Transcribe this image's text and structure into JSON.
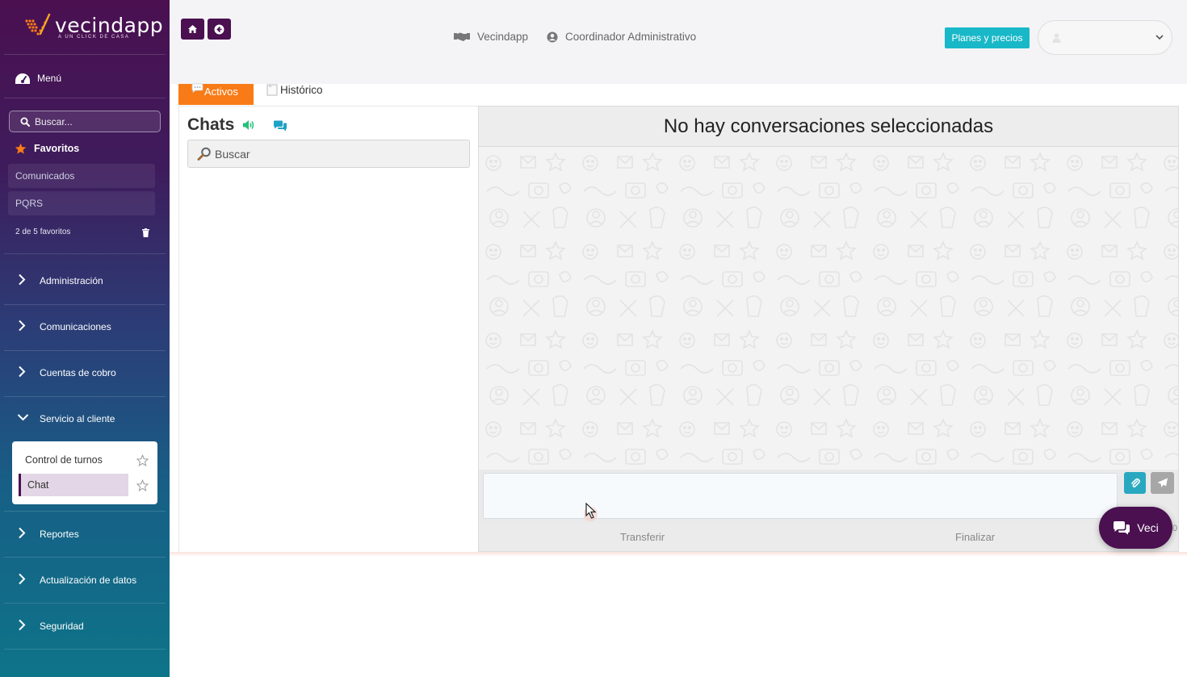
{
  "brand": {
    "name": "vecindapp",
    "tagline": "A UN CLICK DE CASA",
    "colors": {
      "primary": "#4a1050",
      "accent": "#f97b17",
      "teal": "#19b8c8",
      "star": "#f97b17"
    }
  },
  "sidebar": {
    "menu_label": "Menú",
    "search_placeholder": "Buscar...",
    "favorites": {
      "title": "Favoritos",
      "items": [
        "Comunicados",
        "PQRS"
      ],
      "count_text": "2 de 5 favoritos"
    },
    "nav": [
      {
        "label": "Administración",
        "expanded": false
      },
      {
        "label": "Comunicaciones",
        "expanded": false
      },
      {
        "label": "Cuentas de cobro",
        "expanded": false
      },
      {
        "label": "Servicio al cliente",
        "expanded": true,
        "children": [
          {
            "label": "Control de turnos",
            "active": false
          },
          {
            "label": "Chat",
            "active": true
          }
        ]
      },
      {
        "label": "Reportes",
        "expanded": false
      },
      {
        "label": "Actualización de datos",
        "expanded": false
      },
      {
        "label": "Seguridad",
        "expanded": false
      }
    ]
  },
  "topbar": {
    "org_name": "Vecindapp",
    "role": "Coordinador Administrativo",
    "plans_button": "Planes y precios",
    "user_selected": ""
  },
  "tabs": {
    "active": "Activos",
    "history": "Histórico"
  },
  "chat_list": {
    "title": "Chats",
    "search_placeholder": "Buscar"
  },
  "conversation": {
    "header": "No hay conversaciones seleccionadas",
    "message_value": "",
    "footer": {
      "transfer": "Transferir",
      "finish": "Finalizar"
    }
  },
  "floating_chat": {
    "label": "Veci",
    "edge_text": "0"
  },
  "icons": [
    "home-icon",
    "back-arrow-icon",
    "handshake-icon",
    "user-circle-icon",
    "volume-icon",
    "comments-icon",
    "search-icon",
    "star-icon",
    "trash-icon",
    "chevron-right-icon",
    "chevron-down-icon",
    "dashboard-icon",
    "paperclip-icon",
    "send-icon"
  ]
}
